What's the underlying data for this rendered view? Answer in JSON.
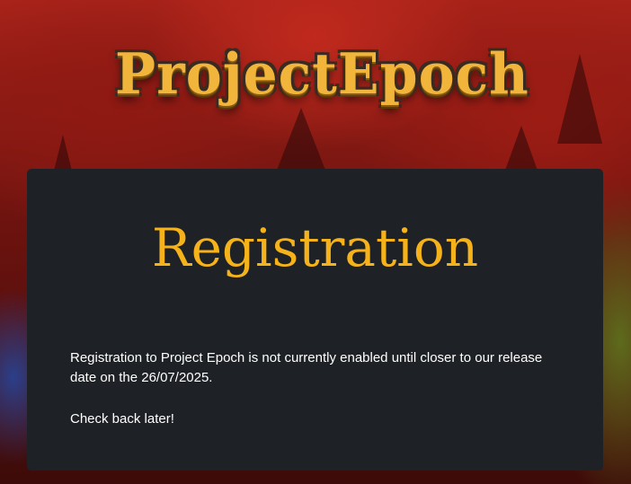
{
  "logo": {
    "text": "ProjectEpoch"
  },
  "panel": {
    "heading": "Registration",
    "message": "Registration to Project Epoch is not currently enabled until closer to our release date on the 26/07/2025.",
    "followup": "Check back later!"
  },
  "colors": {
    "heading": "#f5b21a",
    "panel_background": "#1e2125",
    "body_text": "#ffffff",
    "logo_gold": "#f0b53a"
  }
}
